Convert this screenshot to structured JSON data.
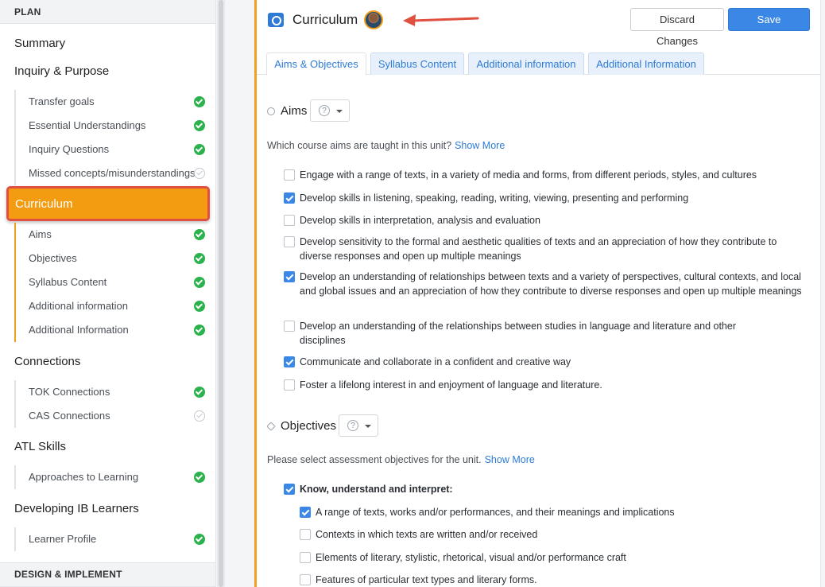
{
  "sidebar": {
    "plan_header": "PLAN",
    "summary": "Summary",
    "inquiry": {
      "title": "Inquiry & Purpose",
      "items": [
        {
          "label": "Transfer goals",
          "done": true
        },
        {
          "label": "Essential Understandings",
          "done": true
        },
        {
          "label": "Inquiry Questions",
          "done": true
        },
        {
          "label": "Missed concepts/misunderstandings",
          "done": false
        }
      ]
    },
    "curriculum": {
      "title": "Curriculum",
      "items": [
        {
          "label": "Aims",
          "done": true
        },
        {
          "label": "Objectives",
          "done": true
        },
        {
          "label": "Syllabus Content",
          "done": true
        },
        {
          "label": "Additional information",
          "done": true
        },
        {
          "label": "Additional Information",
          "done": true
        }
      ]
    },
    "connections": {
      "title": "Connections",
      "items": [
        {
          "label": "TOK Connections",
          "done": true
        },
        {
          "label": "CAS Connections",
          "done": false
        }
      ]
    },
    "atl": {
      "title": "ATL Skills",
      "items": [
        {
          "label": "Approaches to Learning",
          "done": true
        }
      ]
    },
    "learners": {
      "title": "Developing IB Learners",
      "items": [
        {
          "label": "Learner Profile",
          "done": true
        }
      ]
    },
    "design_header": "DESIGN & IMPLEMENT"
  },
  "header": {
    "title": "Curriculum",
    "discard_label": "Discard Changes",
    "save_label": "Save Changes"
  },
  "tabs": [
    {
      "label": "Aims & Objectives",
      "active": true
    },
    {
      "label": "Syllabus Content",
      "active": false
    },
    {
      "label": "Additional information",
      "active": false
    },
    {
      "label": "Additional Information",
      "active": false
    }
  ],
  "aims": {
    "title": "Aims",
    "help": "?",
    "prompt": "Which course aims are taught in this unit?",
    "show_more": "Show More",
    "items": [
      {
        "text": "Engage with a range of texts, in a variety of media and forms, from different periods, styles, and cultures",
        "checked": false
      },
      {
        "text": "Develop skills in listening, speaking, reading, writing, viewing, presenting and performing",
        "checked": true
      },
      {
        "text": "Develop skills in interpretation, analysis and evaluation",
        "checked": false
      },
      {
        "text": "Develop sensitivity to the formal and aesthetic qualities of texts and an appreciation of how they contribute to diverse responses and open up multiple meanings",
        "checked": false
      },
      {
        "text": "Develop an understanding of relationships between texts and a variety of perspectives, cultural contexts, and local and global issues and an appreciation of how they contribute to diverse responses and open up multiple meanings",
        "checked": true
      },
      {
        "text": "Develop an understanding of the relationships between studies in language and literature and other disciplines",
        "checked": false
      },
      {
        "text": "Communicate and collaborate in a confident and creative way",
        "checked": true
      },
      {
        "text": "Foster a lifelong interest in and enjoyment of language and literature.",
        "checked": false
      }
    ]
  },
  "objectives": {
    "title": "Objectives",
    "help": "?",
    "prompt": "Please select assessment objectives for the unit.",
    "show_more": "Show More",
    "group": {
      "text": "Know, understand and interpret:",
      "checked": true
    },
    "items": [
      {
        "text": "A range of texts, works and/or performances, and their meanings and implications",
        "checked": true
      },
      {
        "text": "Contexts in which texts are written and/or received",
        "checked": false
      },
      {
        "text": "Elements of literary, stylistic, rhetorical, visual and/or performance craft",
        "checked": false
      },
      {
        "text": "Features of particular text types and literary forms.",
        "checked": false
      }
    ]
  },
  "colors": {
    "accent": "#f39c12",
    "primary": "#3b87e6",
    "success": "#2bb24c",
    "annotation": "#e05040"
  }
}
